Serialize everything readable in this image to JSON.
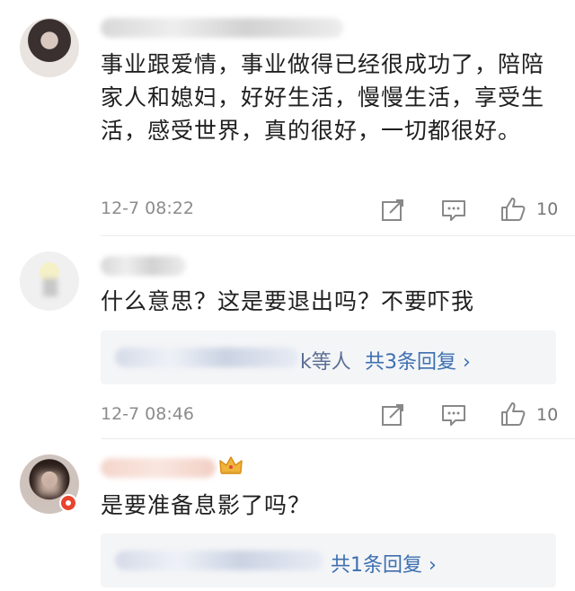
{
  "comments": [
    {
      "text": "事业跟爱情，事业做得已经很成功了，陪陪家人和媳妇，好好生活，慢慢生活，享受生活，感受世界，真的很好，一切都很好。",
      "time": "12-7 08:22",
      "likes": "10",
      "icons": [
        "share-icon",
        "comment-icon",
        "thumbs-up-icon"
      ]
    },
    {
      "text": "什么意思？这是要退出吗？不要吓我",
      "time": "12-7 08:46",
      "likes": "10",
      "replies": {
        "names_suffix": "k等人",
        "link": "共3条回复 ›"
      },
      "icons": [
        "share-icon",
        "comment-icon",
        "thumbs-up-icon"
      ]
    },
    {
      "text": "是要准备息影了吗？",
      "badge_icon": "crown-icon",
      "replies": {
        "link": "共1条回复 ›"
      }
    }
  ],
  "colors": {
    "link": "#3d6fb0",
    "reply_names": "#5b6f94",
    "meta": "#8c8c8c",
    "reply_bg": "#f4f5f7",
    "crown": "#f0b43a"
  }
}
